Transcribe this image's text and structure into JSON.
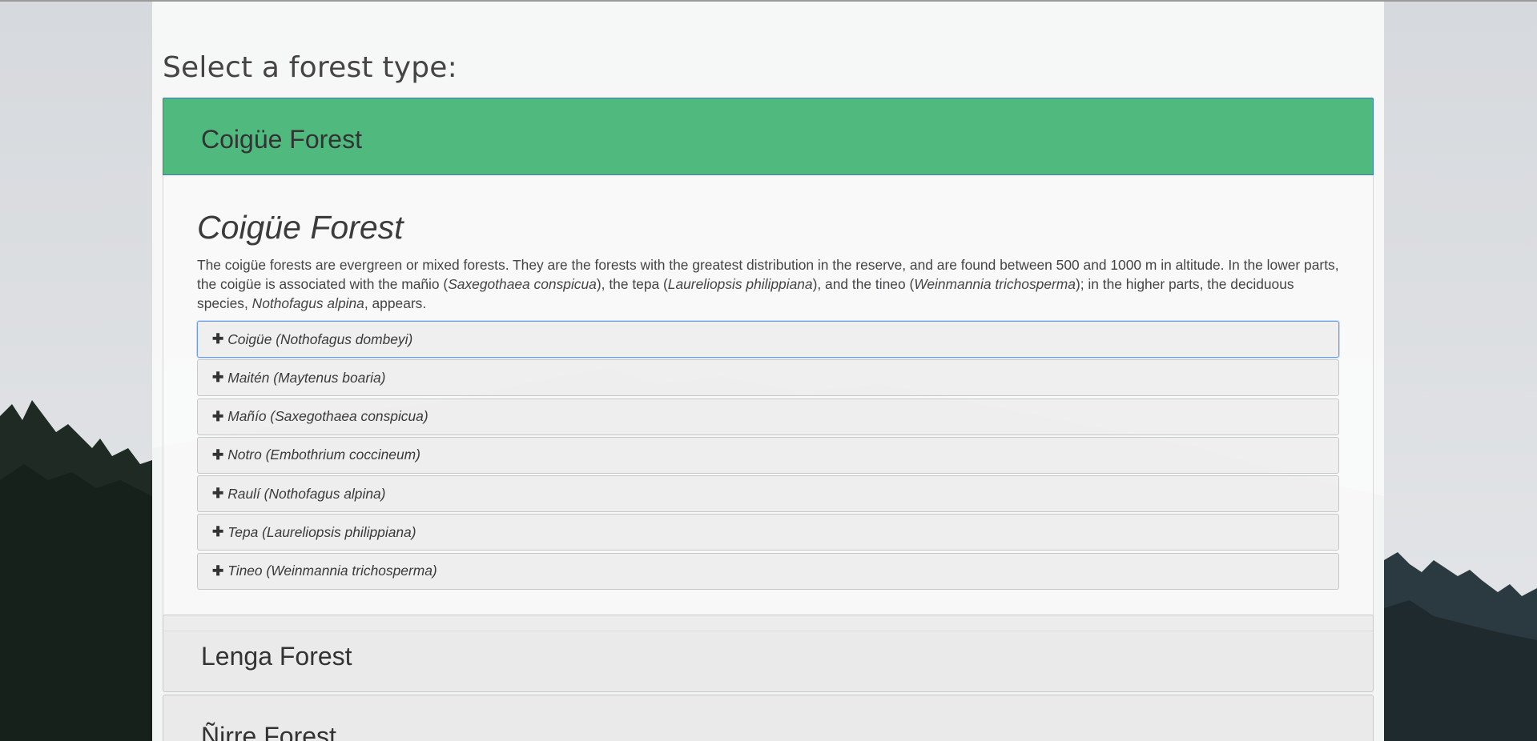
{
  "page": {
    "title": "Select a forest type:"
  },
  "forests": {
    "active": {
      "heading": "Coigüe Forest",
      "title": "Coigüe Forest",
      "description": {
        "p1": "The coigüe forests are evergreen or mixed forests. They are the forests with the greatest distribution in the reserve, and are found between 500 and 1000 m in altitude. In the lower parts, the coigüe is associated with the mañio (",
        "s1": "Saxegothaea conspicua",
        "p2": "), the tepa (",
        "s2": "Laureliopsis philippiana",
        "p3": "), and the tineo (",
        "s3": "Weinmannia trichosperma",
        "p4": "); in the higher parts, the deciduous species, ",
        "s4": "Nothofagus alpina",
        "p5": ", appears."
      },
      "species": [
        {
          "label": "Coigüe (Nothofagus dombeyi)"
        },
        {
          "label": "Maitén (Maytenus boaria)"
        },
        {
          "label": "Mañío (Saxegothaea conspicua)"
        },
        {
          "label": "Notro (Embothrium coccineum)"
        },
        {
          "label": "Raulí (Nothofagus alpina)"
        },
        {
          "label": "Tepa (Laureliopsis philippiana)"
        },
        {
          "label": "Tineo (Weinmannia trichosperma)"
        }
      ]
    },
    "others": [
      {
        "heading": "Lenga Forest"
      },
      {
        "heading": "Ñirre Forest"
      }
    ]
  },
  "icons": {
    "expand": "plus-icon",
    "expand_glyph": "✚"
  },
  "colors": {
    "active_panel": "#4fb97e",
    "focus_border": "#6a9de6"
  }
}
